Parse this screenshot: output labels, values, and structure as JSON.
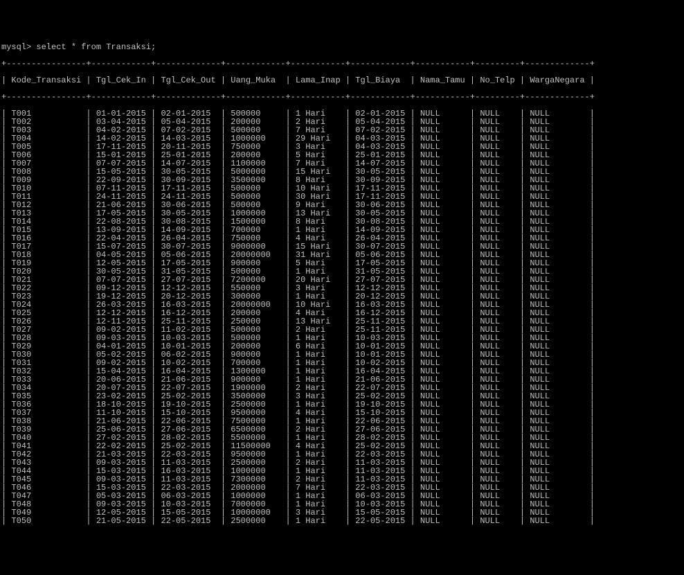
{
  "prompt": "mysql> select * from Transaksi;",
  "border": "+----------------+------------+-------------+------------+-----------+------------+-----------+---------+-------------+",
  "columns": [
    "Kode_Transaksi",
    "Tgl_Cek_In",
    "Tgl_Cek_Out",
    "Uang_Muka",
    "Lama_Inap",
    "Tgl_Biaya",
    "Nama_Tamu",
    "No_Telp",
    "WargaNegara"
  ],
  "rows": [
    {
      "kode": "T001",
      "cekin": "01-01-2015",
      "cekout": "02-01-2015",
      "uang": "500000",
      "lama": "1 Hari",
      "biaya": "02-01-2015",
      "nama": "NULL",
      "telp": "NULL",
      "wn": "NULL"
    },
    {
      "kode": "T002",
      "cekin": "03-04-2015",
      "cekout": "05-04-2015",
      "uang": "200000",
      "lama": "2 Hari",
      "biaya": "05-04-2015",
      "nama": "NULL",
      "telp": "NULL",
      "wn": "NULL"
    },
    {
      "kode": "T003",
      "cekin": "04-02-2015",
      "cekout": "07-02-2015",
      "uang": "500000",
      "lama": "7 Hari",
      "biaya": "07-02-2015",
      "nama": "NULL",
      "telp": "NULL",
      "wn": "NULL"
    },
    {
      "kode": "T004",
      "cekin": "14-02-2015",
      "cekout": "14-03-2015",
      "uang": "1000000",
      "lama": "29 Hari",
      "biaya": "04-03-2015",
      "nama": "NULL",
      "telp": "NULL",
      "wn": "NULL"
    },
    {
      "kode": "T005",
      "cekin": "17-11-2015",
      "cekout": "20-11-2015",
      "uang": "750000",
      "lama": "3 Hari",
      "biaya": "04-03-2015",
      "nama": "NULL",
      "telp": "NULL",
      "wn": "NULL"
    },
    {
      "kode": "T006",
      "cekin": "15-01-2015",
      "cekout": "25-01-2015",
      "uang": "200000",
      "lama": "5 Hari",
      "biaya": "25-01-2015",
      "nama": "NULL",
      "telp": "NULL",
      "wn": "NULL"
    },
    {
      "kode": "T007",
      "cekin": "07-07-2015",
      "cekout": "14-07-2015",
      "uang": "1100000",
      "lama": "7 Hari",
      "biaya": "14-07-2015",
      "nama": "NULL",
      "telp": "NULL",
      "wn": "NULL"
    },
    {
      "kode": "T008",
      "cekin": "15-05-2015",
      "cekout": "30-05-2015",
      "uang": "5000000",
      "lama": "15 Hari",
      "biaya": "30-05-2015",
      "nama": "NULL",
      "telp": "NULL",
      "wn": "NULL"
    },
    {
      "kode": "T009",
      "cekin": "22-09-2015",
      "cekout": "30-09-2015",
      "uang": "3500000",
      "lama": "8 Hari",
      "biaya": "30-09-2015",
      "nama": "NULL",
      "telp": "NULL",
      "wn": "NULL"
    },
    {
      "kode": "T010",
      "cekin": "07-11-2015",
      "cekout": "17-11-2015",
      "uang": "500000",
      "lama": "10 Hari",
      "biaya": "17-11-2015",
      "nama": "NULL",
      "telp": "NULL",
      "wn": "NULL"
    },
    {
      "kode": "T011",
      "cekin": "24-11-2015",
      "cekout": "24-11-2015",
      "uang": "500000",
      "lama": "30 Hari",
      "biaya": "17-11-2015",
      "nama": "NULL",
      "telp": "NULL",
      "wn": "NULL"
    },
    {
      "kode": "T012",
      "cekin": "21-06-2015",
      "cekout": "30-06-2015",
      "uang": "500000",
      "lama": "9 Hari",
      "biaya": "30-06-2015",
      "nama": "NULL",
      "telp": "NULL",
      "wn": "NULL"
    },
    {
      "kode": "T013",
      "cekin": "17-05-2015",
      "cekout": "30-05-2015",
      "uang": "1000000",
      "lama": "13 Hari",
      "biaya": "30-05-2015",
      "nama": "NULL",
      "telp": "NULL",
      "wn": "NULL"
    },
    {
      "kode": "T014",
      "cekin": "22-08-2015",
      "cekout": "30-08-2015",
      "uang": "1500000",
      "lama": "8 Hari",
      "biaya": "30-08-2015",
      "nama": "NULL",
      "telp": "NULL",
      "wn": "NULL"
    },
    {
      "kode": "T015",
      "cekin": "13-09-2015",
      "cekout": "14-09-2015",
      "uang": "700000",
      "lama": "1 Hari",
      "biaya": "14-09-2015",
      "nama": "NULL",
      "telp": "NULL",
      "wn": "NULL"
    },
    {
      "kode": "T016",
      "cekin": "22-04-2015",
      "cekout": "26-04-2015",
      "uang": "750000",
      "lama": "4 Hari",
      "biaya": "26-04-2015",
      "nama": "NULL",
      "telp": "NULL",
      "wn": "NULL"
    },
    {
      "kode": "T017",
      "cekin": "15-07-2015",
      "cekout": "30-07-2015",
      "uang": "9000000",
      "lama": "15 Hari",
      "biaya": "30-07-2015",
      "nama": "NULL",
      "telp": "NULL",
      "wn": "NULL"
    },
    {
      "kode": "T018",
      "cekin": "04-05-2015",
      "cekout": "05-06-2015",
      "uang": "20000000",
      "lama": "31 Hari",
      "biaya": "05-06-2015",
      "nama": "NULL",
      "telp": "NULL",
      "wn": "NULL"
    },
    {
      "kode": "T019",
      "cekin": "12-05-2015",
      "cekout": "17-05-2015",
      "uang": "900000",
      "lama": "5 Hari",
      "biaya": "17-05-2015",
      "nama": "NULL",
      "telp": "NULL",
      "wn": "NULL"
    },
    {
      "kode": "T020",
      "cekin": "30-05-2015",
      "cekout": "31-05-2015",
      "uang": "500000",
      "lama": "1 Hari",
      "biaya": "31-05-2015",
      "nama": "NULL",
      "telp": "NULL",
      "wn": "NULL"
    },
    {
      "kode": "T021",
      "cekin": "07-07-2015",
      "cekout": "27-07-2015",
      "uang": "7200000",
      "lama": "20 Hari",
      "biaya": "27-07-2015",
      "nama": "NULL",
      "telp": "NULL",
      "wn": "NULL"
    },
    {
      "kode": "T022",
      "cekin": "09-12-2015",
      "cekout": "12-12-2015",
      "uang": "550000",
      "lama": "3 Hari",
      "biaya": "12-12-2015",
      "nama": "NULL",
      "telp": "NULL",
      "wn": "NULL"
    },
    {
      "kode": "T023",
      "cekin": "19-12-2015",
      "cekout": "20-12-2015",
      "uang": "300000",
      "lama": "1 Hari",
      "biaya": "20-12-2015",
      "nama": "NULL",
      "telp": "NULL",
      "wn": "NULL"
    },
    {
      "kode": "T024",
      "cekin": "26-03-2015",
      "cekout": "16-03-2015",
      "uang": "20000000",
      "lama": "10 Hari",
      "biaya": "16-03-2015",
      "nama": "NULL",
      "telp": "NULL",
      "wn": "NULL"
    },
    {
      "kode": "T025",
      "cekin": "12-12-2015",
      "cekout": "16-12-2015",
      "uang": "200000",
      "lama": "4 Hari",
      "biaya": "16-12-2015",
      "nama": "NULL",
      "telp": "NULL",
      "wn": "NULL"
    },
    {
      "kode": "T026",
      "cekin": "12-11-2015",
      "cekout": "25-11-2015",
      "uang": "250000",
      "lama": "13 Hari",
      "biaya": "25-11-2015",
      "nama": "NULL",
      "telp": "NULL",
      "wn": "NULL"
    },
    {
      "kode": "T027",
      "cekin": "09-02-2015",
      "cekout": "11-02-2015",
      "uang": "500000",
      "lama": "2 Hari",
      "biaya": "25-11-2015",
      "nama": "NULL",
      "telp": "NULL",
      "wn": "NULL"
    },
    {
      "kode": "T028",
      "cekin": "09-03-2015",
      "cekout": "10-03-2015",
      "uang": "500000",
      "lama": "1 Hari",
      "biaya": "10-03-2015",
      "nama": "NULL",
      "telp": "NULL",
      "wn": "NULL"
    },
    {
      "kode": "T029",
      "cekin": "04-01-2015",
      "cekout": "10-01-2015",
      "uang": "200000",
      "lama": "6 Hari",
      "biaya": "10-01-2015",
      "nama": "NULL",
      "telp": "NULL",
      "wn": "NULL"
    },
    {
      "kode": "T030",
      "cekin": "05-02-2015",
      "cekout": "06-02-2015",
      "uang": "900000",
      "lama": "1 Hari",
      "biaya": "10-01-2015",
      "nama": "NULL",
      "telp": "NULL",
      "wn": "NULL"
    },
    {
      "kode": "T031",
      "cekin": "09-02-2015",
      "cekout": "10-02-2015",
      "uang": "700000",
      "lama": "1 Hari",
      "biaya": "10-02-2015",
      "nama": "NULL",
      "telp": "NULL",
      "wn": "NULL"
    },
    {
      "kode": "T032",
      "cekin": "15-04-2015",
      "cekout": "16-04-2015",
      "uang": "1300000",
      "lama": "1 Hari",
      "biaya": "16-04-2015",
      "nama": "NULL",
      "telp": "NULL",
      "wn": "NULL"
    },
    {
      "kode": "T033",
      "cekin": "20-06-2015",
      "cekout": "21-06-2015",
      "uang": "900000",
      "lama": "1 Hari",
      "biaya": "21-06-2015",
      "nama": "NULL",
      "telp": "NULL",
      "wn": "NULL"
    },
    {
      "kode": "T034",
      "cekin": "20-07-2015",
      "cekout": "22-07-2015",
      "uang": "1900000",
      "lama": "2 Hari",
      "biaya": "22-07-2015",
      "nama": "NULL",
      "telp": "NULL",
      "wn": "NULL"
    },
    {
      "kode": "T035",
      "cekin": "23-02-2015",
      "cekout": "25-02-2015",
      "uang": "3500000",
      "lama": "3 Hari",
      "biaya": "25-02-2015",
      "nama": "NULL",
      "telp": "NULL",
      "wn": "NULL"
    },
    {
      "kode": "T036",
      "cekin": "18-10-2015",
      "cekout": "19-10-2015",
      "uang": "2500000",
      "lama": "1 Hari",
      "biaya": "19-10-2015",
      "nama": "NULL",
      "telp": "NULL",
      "wn": "NULL"
    },
    {
      "kode": "T037",
      "cekin": "11-10-2015",
      "cekout": "15-10-2015",
      "uang": "9500000",
      "lama": "4 Hari",
      "biaya": "15-10-2015",
      "nama": "NULL",
      "telp": "NULL",
      "wn": "NULL"
    },
    {
      "kode": "T038",
      "cekin": "21-06-2015",
      "cekout": "22-06-2015",
      "uang": "7500000",
      "lama": "1 Hari",
      "biaya": "22-06-2015",
      "nama": "NULL",
      "telp": "NULL",
      "wn": "NULL"
    },
    {
      "kode": "T039",
      "cekin": "25-06-2015",
      "cekout": "27-06-2015",
      "uang": "6500000",
      "lama": "2 Hari",
      "biaya": "27-06-2015",
      "nama": "NULL",
      "telp": "NULL",
      "wn": "NULL"
    },
    {
      "kode": "T040",
      "cekin": "27-02-2015",
      "cekout": "28-02-2015",
      "uang": "5500000",
      "lama": "1 Hari",
      "biaya": "28-02-2015",
      "nama": "NULL",
      "telp": "NULL",
      "wn": "NULL"
    },
    {
      "kode": "T041",
      "cekin": "22-02-2015",
      "cekout": "25-02-2015",
      "uang": "11500000",
      "lama": "4 Hari",
      "biaya": "25-02-2015",
      "nama": "NULL",
      "telp": "NULL",
      "wn": "NULL"
    },
    {
      "kode": "T042",
      "cekin": "21-03-2015",
      "cekout": "22-03-2015",
      "uang": "9500000",
      "lama": "1 Hari",
      "biaya": "22-03-2015",
      "nama": "NULL",
      "telp": "NULL",
      "wn": "NULL"
    },
    {
      "kode": "T043",
      "cekin": "09-03-2015",
      "cekout": "11-03-2015",
      "uang": "2500000",
      "lama": "2 Hari",
      "biaya": "11-03-2015",
      "nama": "NULL",
      "telp": "NULL",
      "wn": "NULL"
    },
    {
      "kode": "T044",
      "cekin": "15-03-2015",
      "cekout": "16-03-2015",
      "uang": "1000000",
      "lama": "1 Hari",
      "biaya": "11-03-2015",
      "nama": "NULL",
      "telp": "NULL",
      "wn": "NULL"
    },
    {
      "kode": "T045",
      "cekin": "09-03-2015",
      "cekout": "11-03-2015",
      "uang": "7300000",
      "lama": "2 Hari",
      "biaya": "11-03-2015",
      "nama": "NULL",
      "telp": "NULL",
      "wn": "NULL"
    },
    {
      "kode": "T046",
      "cekin": "15-03-2015",
      "cekout": "22-03-2015",
      "uang": "2000000",
      "lama": "7 Hari",
      "biaya": "22-03-2015",
      "nama": "NULL",
      "telp": "NULL",
      "wn": "NULL"
    },
    {
      "kode": "T047",
      "cekin": "05-03-2015",
      "cekout": "06-03-2015",
      "uang": "1000000",
      "lama": "1 Hari",
      "biaya": "06-03-2015",
      "nama": "NULL",
      "telp": "NULL",
      "wn": "NULL"
    },
    {
      "kode": "T048",
      "cekin": "09-03-2015",
      "cekout": "10-03-2015",
      "uang": "7000000",
      "lama": "1 Hari",
      "biaya": "10-03-2015",
      "nama": "NULL",
      "telp": "NULL",
      "wn": "NULL"
    },
    {
      "kode": "T049",
      "cekin": "12-05-2015",
      "cekout": "15-05-2015",
      "uang": "10000000",
      "lama": "3 Hari",
      "biaya": "15-05-2015",
      "nama": "NULL",
      "telp": "NULL",
      "wn": "NULL"
    },
    {
      "kode": "T050",
      "cekin": "21-05-2015",
      "cekout": "22-05-2015",
      "uang": "2500000",
      "lama": "1 Hari",
      "biaya": "22-05-2015",
      "nama": "NULL",
      "telp": "NULL",
      "wn": "NULL"
    }
  ]
}
